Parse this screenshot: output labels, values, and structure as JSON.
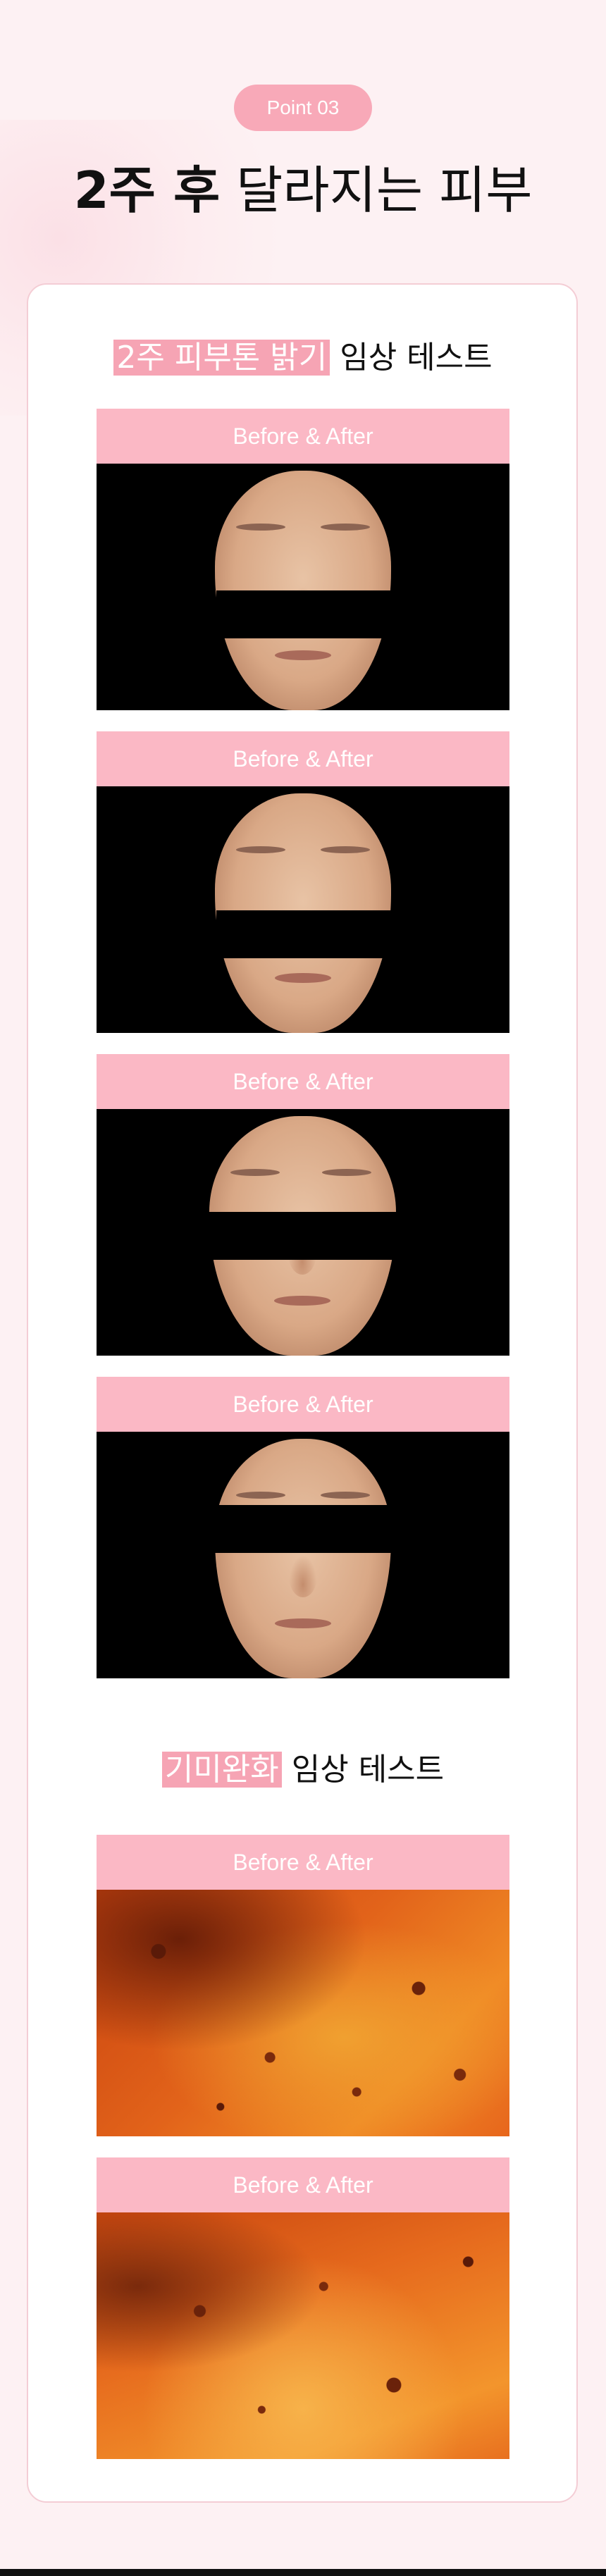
{
  "header": {
    "badge": "Point 03",
    "headline_bold": "2주 후",
    "headline_rest": " 달라지는 피부"
  },
  "sections": [
    {
      "title_highlight": "2주 피부톤 밝기",
      "title_rest": " 임상 테스트",
      "panels": [
        {
          "label": "Before & After"
        },
        {
          "label": "Before & After"
        },
        {
          "label": "Before & After"
        },
        {
          "label": "Before & After"
        }
      ]
    },
    {
      "title_highlight": "기미완화",
      "title_rest": " 임상 테스트",
      "panels": [
        {
          "label": "Before & After"
        },
        {
          "label": "Before & After"
        }
      ]
    }
  ],
  "colors": {
    "accent": "#f8a9b8",
    "bar": "#fbb8c5",
    "background": "#fdf1f3"
  }
}
